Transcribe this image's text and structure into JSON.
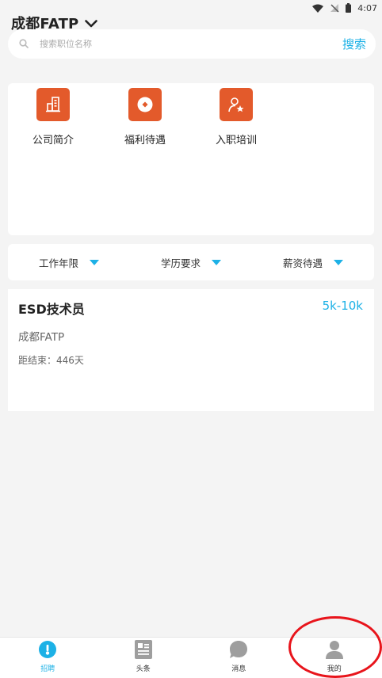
{
  "status_bar": {
    "time": "4:07"
  },
  "header": {
    "city": "成都FATP"
  },
  "search": {
    "placeholder": "搜索职位名称",
    "button_label": "搜索"
  },
  "categories": [
    {
      "label": "公司简介",
      "icon": "building-icon"
    },
    {
      "label": "福利待遇",
      "icon": "coin-icon"
    },
    {
      "label": "入职培训",
      "icon": "person-star-icon"
    }
  ],
  "filters": [
    {
      "label": "工作年限"
    },
    {
      "label": "学历要求"
    },
    {
      "label": "薪资待遇"
    }
  ],
  "job": {
    "title": "ESD技术员",
    "salary": "5k-10k",
    "location": "成都FATP",
    "deadline": "距结束：446天"
  },
  "bottom_nav": [
    {
      "label": "招聘",
      "icon": "recruit-icon",
      "active": true
    },
    {
      "label": "头条",
      "icon": "news-icon",
      "active": false
    },
    {
      "label": "消息",
      "icon": "message-icon",
      "active": false
    },
    {
      "label": "我的",
      "icon": "profile-icon",
      "active": false
    }
  ],
  "colors": {
    "accent": "#1db1e6",
    "category_icon": "#e35a2b",
    "annotation": "#e8141b"
  }
}
